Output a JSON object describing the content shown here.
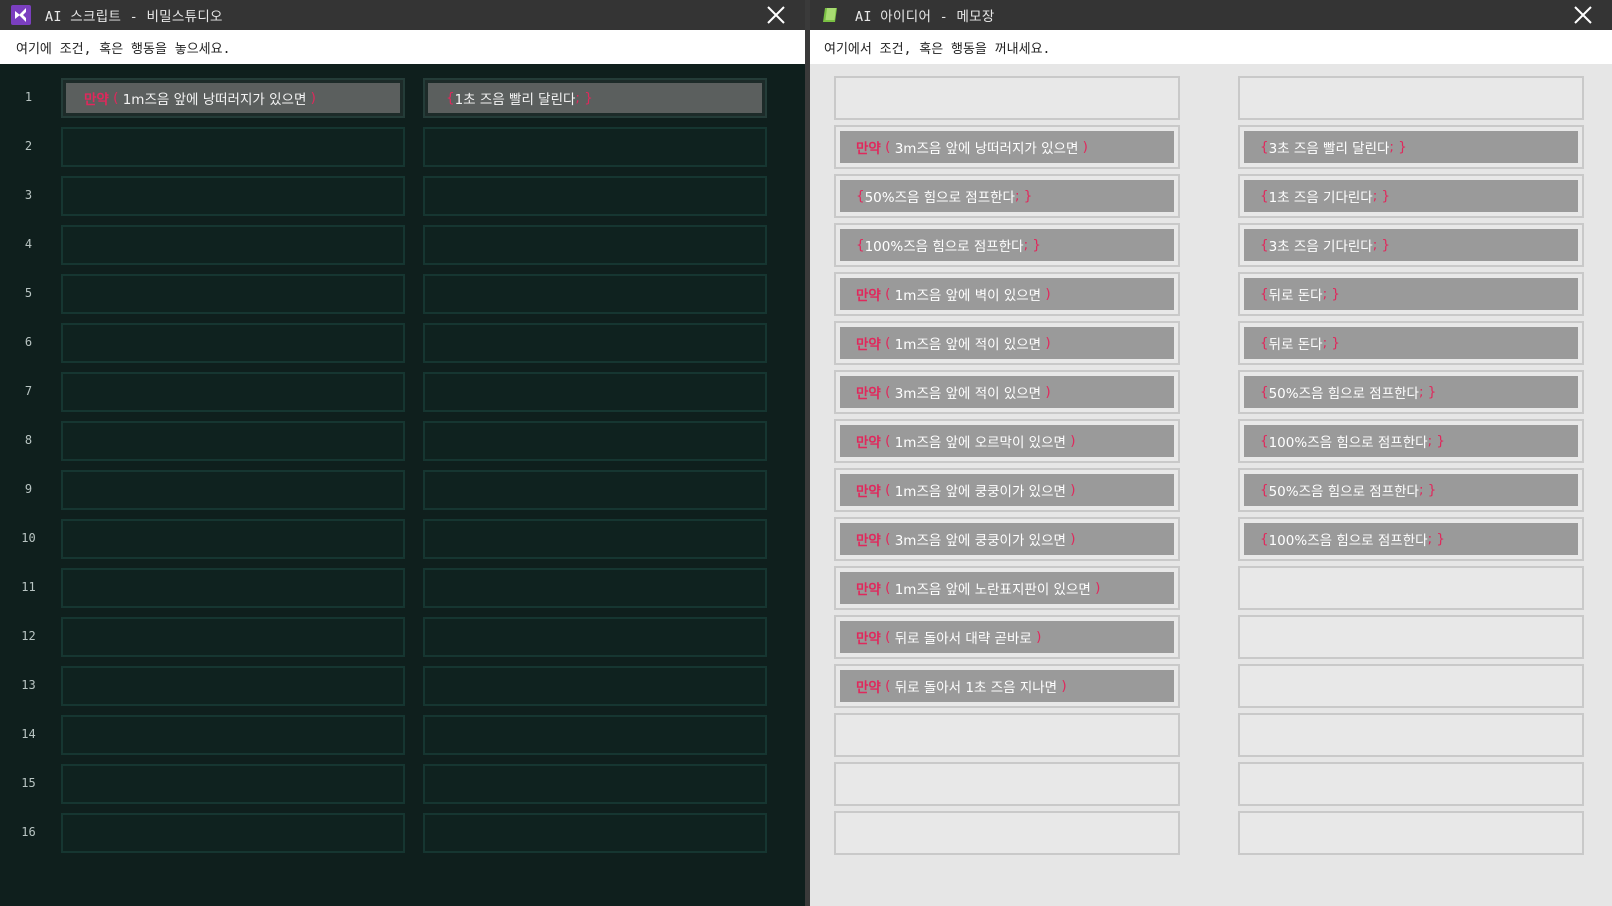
{
  "left_window": {
    "title": "AI 스크립트 - 비밀스튜디오",
    "app_icon": "visual-studio-icon",
    "instruction": "여기에 조건, 혹은 행동을 놓으세요.",
    "row_numbers": [
      "1",
      "2",
      "3",
      "4",
      "5",
      "6",
      "7",
      "8",
      "9",
      "10",
      "11",
      "12",
      "13",
      "14",
      "15",
      "16"
    ],
    "row1_condition": {
      "keyword": "만약",
      "open": "(",
      "text": " 1m즈음 앞에 낭떠러지가 있으면 ",
      "close": ")"
    },
    "row1_action": {
      "open": "{",
      "text": "1초 즈음 빨리 달린다",
      "close": "; }"
    }
  },
  "right_window": {
    "title": "AI 아이디어 - 메모장",
    "app_icon": "notepad-icon",
    "instruction": "여기에서 조건, 혹은 행동을 꺼내세요.",
    "conditions": [
      null,
      {
        "keyword": "만약",
        "open": "(",
        "text": " 3m즈음 앞에 낭떠러지가 있으면 ",
        "close": ")"
      },
      {
        "open": "{",
        "text": "50%즈음 힘으로 점프한다",
        "close": "; }"
      },
      {
        "open": "{",
        "text": "100%즈음 힘으로 점프한다",
        "close": "; }"
      },
      {
        "keyword": "만약",
        "open": "(",
        "text": " 1m즈음 앞에 벽이 있으면 ",
        "close": ")"
      },
      {
        "keyword": "만약",
        "open": "(",
        "text": " 1m즈음 앞에 적이 있으면 ",
        "close": ")"
      },
      {
        "keyword": "만약",
        "open": "(",
        "text": " 3m즈음 앞에 적이 있으면 ",
        "close": ")"
      },
      {
        "keyword": "만약",
        "open": "(",
        "text": " 1m즈음 앞에 오르막이 있으면 ",
        "close": ")"
      },
      {
        "keyword": "만약",
        "open": "(",
        "text": " 1m즈음 앞에 쿵쿵이가 있으면 ",
        "close": ")"
      },
      {
        "keyword": "만약",
        "open": "(",
        "text": " 3m즈음 앞에 쿵쿵이가 있으면 ",
        "close": ")"
      },
      {
        "keyword": "만약",
        "open": "(",
        "text": " 1m즈음 앞에 노란표지판이 있으면 ",
        "close": ")"
      },
      {
        "keyword": "만약",
        "open": "(",
        "text": " 뒤로 돌아서 대략 곧바로 ",
        "close": ")"
      },
      {
        "keyword": "만약",
        "open": "(",
        "text": " 뒤로 돌아서 1초 즈음 지나면 ",
        "close": ")"
      },
      null,
      null,
      null
    ],
    "actions": [
      null,
      {
        "open": "{",
        "text": "3초 즈음 빨리 달린다",
        "close": "; }"
      },
      {
        "open": "{",
        "text": "1초 즈음 기다린다",
        "close": "; }"
      },
      {
        "open": "{",
        "text": "3초 즈음 기다린다",
        "close": "; }"
      },
      {
        "open": "{",
        "text": "뒤로 돈다",
        "close": "; }"
      },
      {
        "open": "{",
        "text": "뒤로 돈다",
        "close": "; }"
      },
      {
        "open": "{",
        "text": "50%즈음 힘으로 점프한다",
        "close": "; }"
      },
      {
        "open": "{",
        "text": "100%즈음 힘으로 점프한다",
        "close": "; }"
      },
      {
        "open": "{",
        "text": "50%즈음 힘으로 점프한다",
        "close": "; }"
      },
      {
        "open": "{",
        "text": "100%즈음 힘으로 점프한다",
        "close": "; }"
      },
      null,
      null,
      null,
      null,
      null,
      null
    ]
  },
  "colors": {
    "keyword": "#e0285c",
    "left_bg": "#0f1f1d",
    "right_bg": "#e6e6e6",
    "titlebar": "#343434"
  }
}
